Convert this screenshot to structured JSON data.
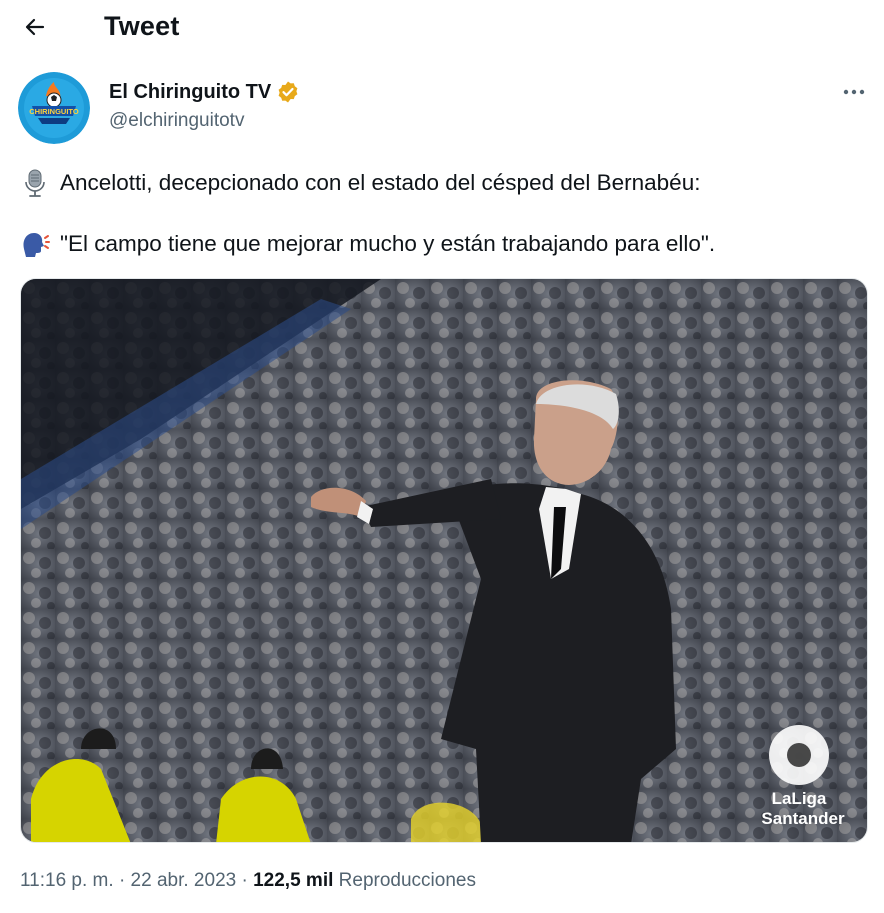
{
  "header": {
    "title": "Tweet",
    "back_icon": "arrow-left-icon"
  },
  "author": {
    "display_name": "El Chiringuito TV",
    "handle": "@elchiringuitotv",
    "verified": true,
    "verified_color": "#e8a91a",
    "avatar_text": "CHIRINGUITO",
    "avatar_colors": {
      "bg": "#1e9bd8",
      "badge": "#1350a8",
      "flame": "#f47a20"
    }
  },
  "more_icon": "ellipsis-icon",
  "tweet": {
    "line1_icon": "microphone-icon",
    "line1": "Ancelotti, decepcionado con el estado del césped del Bernabéu:",
    "line2_icon": "speaking-head-icon",
    "line2": "\"El campo tiene que mejorar mucho y están trabajando para ello\"."
  },
  "media": {
    "alt": "Ancelotti gesturing on the touchline in front of a crowd",
    "watermark_line1": "LaLiga",
    "watermark_line2": "Santander"
  },
  "meta": {
    "time": "11:16 p. m.",
    "separator": "·",
    "date": "22 abr. 2023",
    "views_count": "122,5 mil",
    "views_label": "Reproducciones"
  }
}
